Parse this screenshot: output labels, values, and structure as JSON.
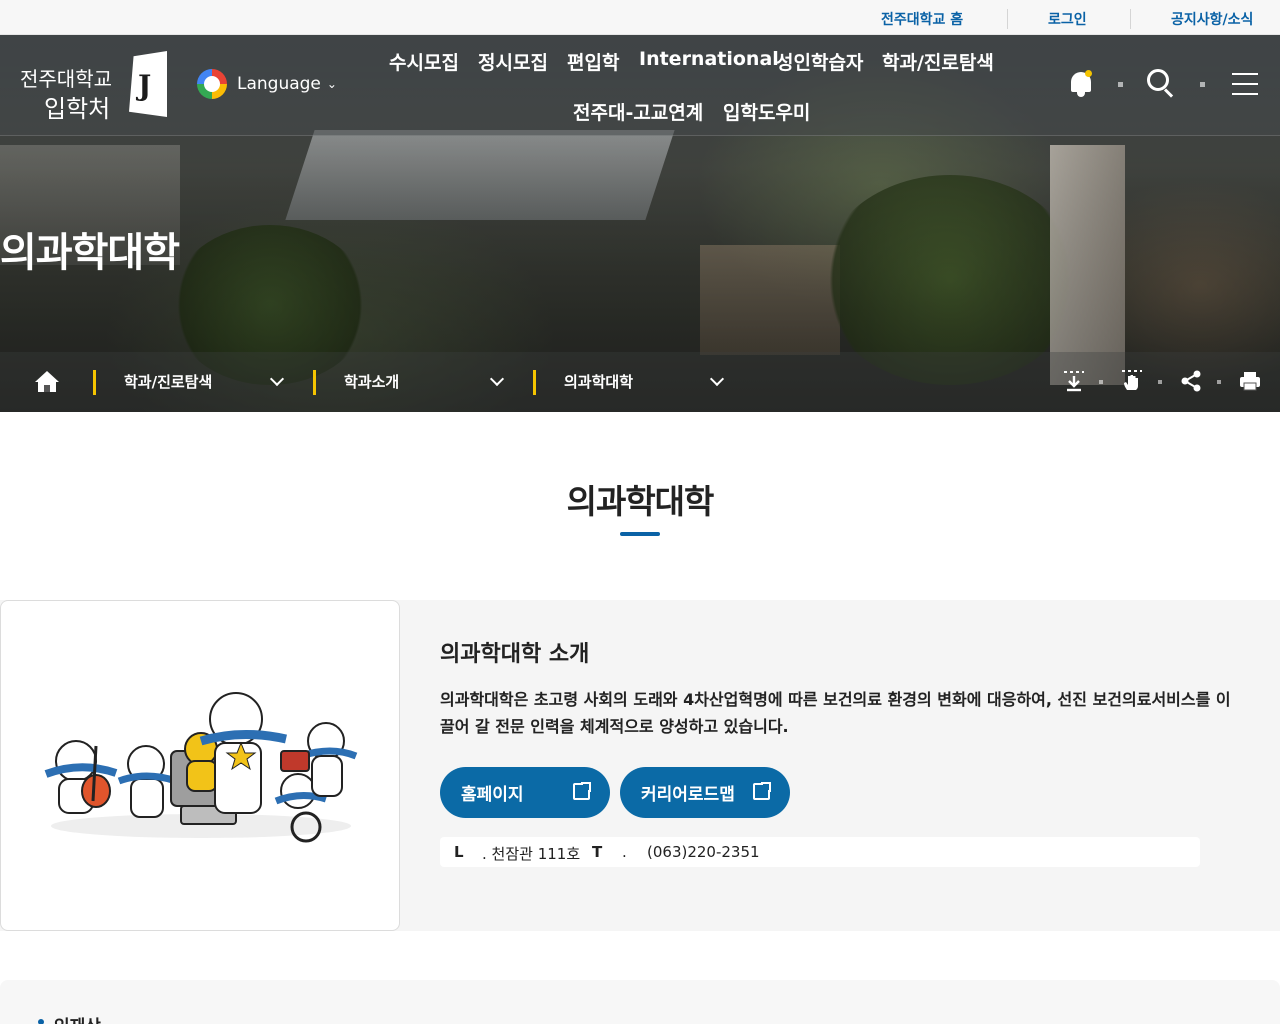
{
  "utility": {
    "links": [
      "전주대학교 홈",
      "로그인",
      "공지사항/소식"
    ]
  },
  "header": {
    "logo_line1": "전주대학교",
    "logo_line2": "입학처",
    "logo_mark": "J",
    "language_label": "Language",
    "gnb": [
      "수시모집",
      "정시모집",
      "편입학",
      "International",
      "성인학습자",
      "학과/진로탐색",
      "전주대-고교연계",
      "입학도우미"
    ],
    "icons": [
      "bell-icon",
      "search-icon",
      "menu-icon"
    ],
    "notification_dot_color": "#f5c400"
  },
  "hero": {
    "title": "의과학대학"
  },
  "breadcrumb": {
    "items": [
      "학과/진로탐색",
      "학과소개",
      "의과학대학"
    ],
    "tools": [
      "download-icon",
      "touch-icon",
      "share-icon",
      "print-icon"
    ]
  },
  "main": {
    "title": "의과학대학",
    "intro_heading": "의과학대학 소개",
    "intro_text": "의과학대학은 초고령 사회의 도래와 4차산업혁명에 따른 보건의료 환경의 변화에 대응하여, 선진 보건의료서비스를 이끌어 갈 전문 인력을 체계적으로 양성하고 있습니다.",
    "buttons": [
      "홈페이지",
      "커리어로드맵"
    ],
    "contact": {
      "location_key": "L",
      "location_value": ". 천잠관 111호",
      "tel_key": "T",
      "tel_sep": ".",
      "tel_value": "(063)220-2351"
    },
    "section2_title": "인재상"
  },
  "colors": {
    "accent": "#0a62a6",
    "button": "#0b6aa6",
    "crumb_marker": "#f5c400"
  }
}
